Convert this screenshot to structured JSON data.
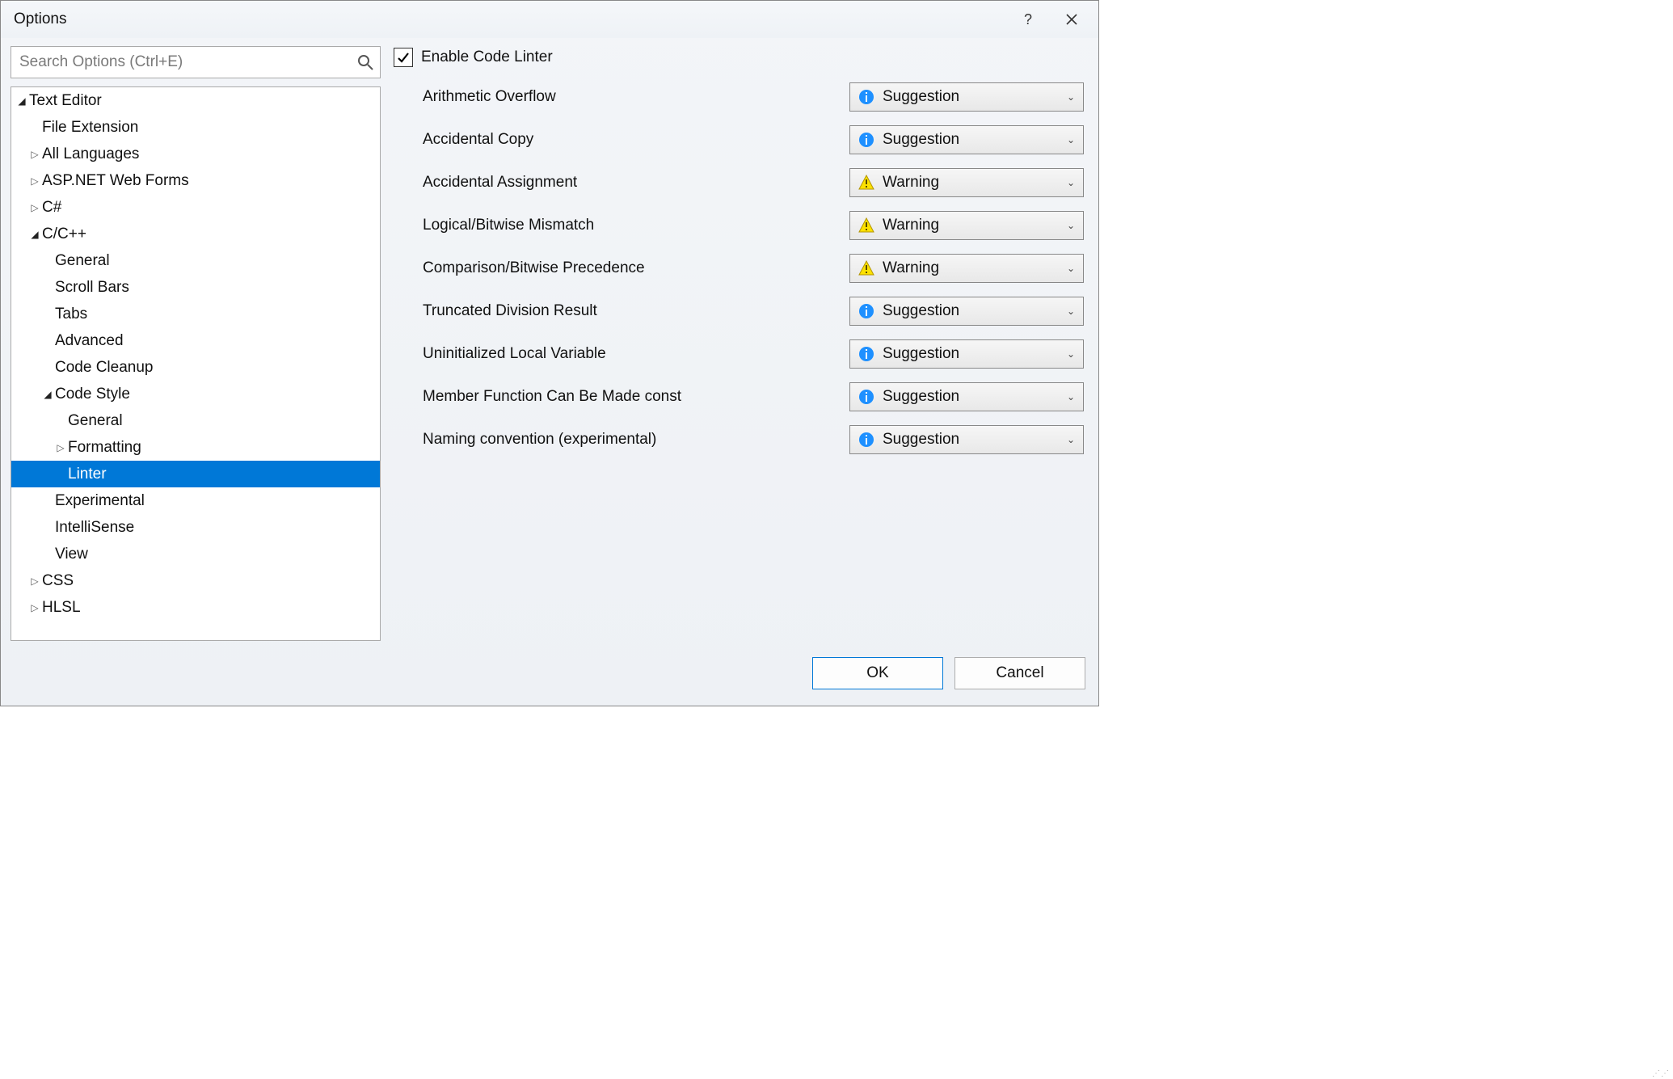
{
  "title": "Options",
  "search": {
    "placeholder": "Search Options (Ctrl+E)"
  },
  "tree": [
    {
      "label": "Text Editor",
      "indent": 0,
      "toggle": "down"
    },
    {
      "label": "File Extension",
      "indent": 1,
      "toggle": "none"
    },
    {
      "label": "All Languages",
      "indent": 1,
      "toggle": "right"
    },
    {
      "label": "ASP.NET Web Forms",
      "indent": 1,
      "toggle": "right"
    },
    {
      "label": "C#",
      "indent": 1,
      "toggle": "right"
    },
    {
      "label": "C/C++",
      "indent": 1,
      "toggle": "down"
    },
    {
      "label": "General",
      "indent": 2,
      "toggle": "none"
    },
    {
      "label": "Scroll Bars",
      "indent": 2,
      "toggle": "none"
    },
    {
      "label": "Tabs",
      "indent": 2,
      "toggle": "none"
    },
    {
      "label": "Advanced",
      "indent": 2,
      "toggle": "none"
    },
    {
      "label": "Code Cleanup",
      "indent": 2,
      "toggle": "none"
    },
    {
      "label": "Code Style",
      "indent": 2,
      "toggle": "down"
    },
    {
      "label": "General",
      "indent": 3,
      "toggle": "none"
    },
    {
      "label": "Formatting",
      "indent": 3,
      "toggle": "right"
    },
    {
      "label": "Linter",
      "indent": 3,
      "toggle": "none",
      "selected": true
    },
    {
      "label": "Experimental",
      "indent": 2,
      "toggle": "none"
    },
    {
      "label": "IntelliSense",
      "indent": 2,
      "toggle": "none"
    },
    {
      "label": "View",
      "indent": 2,
      "toggle": "none"
    },
    {
      "label": "CSS",
      "indent": 1,
      "toggle": "right"
    },
    {
      "label": "HLSL",
      "indent": 1,
      "toggle": "right"
    }
  ],
  "enable_linter_label": "Enable Code Linter",
  "enable_linter_checked": true,
  "rules": [
    {
      "label": "Arithmetic Overflow",
      "severity": "Suggestion",
      "icon": "info"
    },
    {
      "label": "Accidental Copy",
      "severity": "Suggestion",
      "icon": "info"
    },
    {
      "label": "Accidental Assignment",
      "severity": "Warning",
      "icon": "warn"
    },
    {
      "label": "Logical/Bitwise Mismatch",
      "severity": "Warning",
      "icon": "warn"
    },
    {
      "label": "Comparison/Bitwise Precedence",
      "severity": "Warning",
      "icon": "warn"
    },
    {
      "label": "Truncated Division Result",
      "severity": "Suggestion",
      "icon": "info"
    },
    {
      "label": "Uninitialized Local Variable",
      "severity": "Suggestion",
      "icon": "info"
    },
    {
      "label": "Member Function Can Be Made const",
      "severity": "Suggestion",
      "icon": "info"
    },
    {
      "label": "Naming convention (experimental)",
      "severity": "Suggestion",
      "icon": "info"
    }
  ],
  "buttons": {
    "ok": "OK",
    "cancel": "Cancel"
  }
}
